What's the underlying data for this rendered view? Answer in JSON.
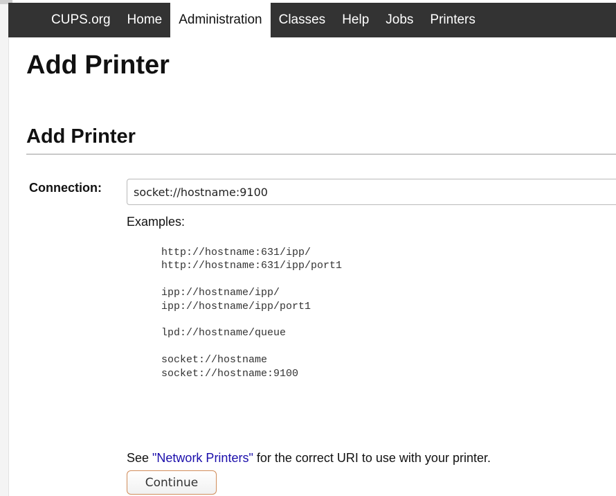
{
  "nav": {
    "items": [
      {
        "label": "CUPS.org"
      },
      {
        "label": "Home"
      },
      {
        "label": "Administration"
      },
      {
        "label": "Classes"
      },
      {
        "label": "Help"
      },
      {
        "label": "Jobs"
      },
      {
        "label": "Printers"
      }
    ],
    "active": "Administration"
  },
  "page": {
    "title": "Add Printer",
    "section_title": "Add Printer"
  },
  "form": {
    "connection_label": "Connection:",
    "connection_value": "socket://hostname:9100",
    "examples_label": "Examples:",
    "examples": "http://hostname:631/ipp/\nhttp://hostname:631/ipp/port1\n\nipp://hostname/ipp/\nipp://hostname/ipp/port1\n\nlpd://hostname/queue\n\nsocket://hostname\nsocket://hostname:9100",
    "note_prefix": "See ",
    "note_link": "\"Network Printers\"",
    "note_suffix": " for the correct URI to use with your printer.",
    "continue_label": "Continue"
  },
  "colors": {
    "navbar_bg": "#333333",
    "link": "#1a0dab",
    "button_border": "#d08c5a"
  }
}
